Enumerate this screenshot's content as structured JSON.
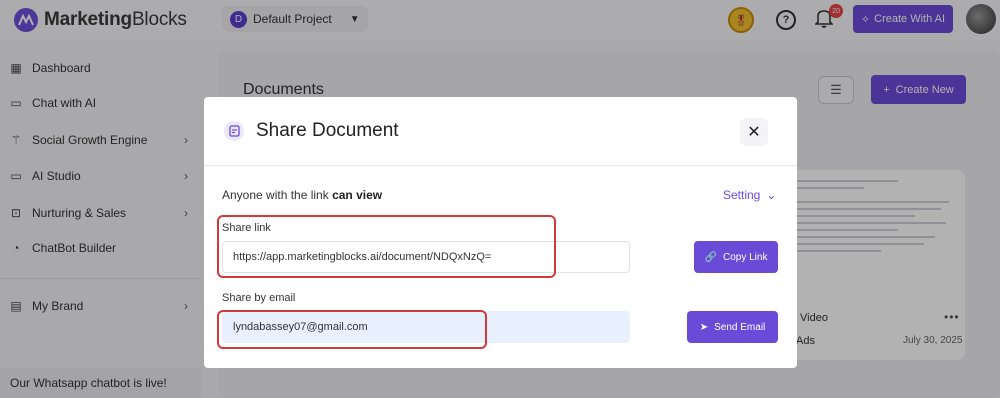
{
  "app": {
    "brand_bold": "Marketing",
    "brand_light": "Blocks"
  },
  "topbar": {
    "project_initial": "D",
    "project_name": "Default Project",
    "notifications_count": "20",
    "create_ai_label": "Create With AI"
  },
  "sidebar": {
    "items": [
      {
        "label": "Dashboard",
        "icon": "dashboard-icon"
      },
      {
        "label": "Chat with AI",
        "icon": "chat-icon"
      },
      {
        "label": "Social Growth Engine",
        "icon": "wand-icon"
      },
      {
        "label": "AI Studio",
        "icon": "monitor-icon"
      },
      {
        "label": "Nurturing & Sales",
        "icon": "presentation-icon"
      },
      {
        "label": "ChatBot Builder",
        "icon": "bot-icon"
      },
      {
        "label": "My Brand",
        "icon": "brand-icon"
      }
    ],
    "whatsapp_notice": "Our Whatsapp chatbot is live!"
  },
  "main": {
    "title": "Documents",
    "create_new_label": "Create New",
    "card": {
      "title": "Video",
      "subtitle": "Ads",
      "date": "July 30, 2025"
    }
  },
  "modal": {
    "title": "Share Document",
    "access_prefix": "Anyone with the link",
    "access_level": "can view",
    "setting_label": "Setting",
    "share_link_label": "Share link",
    "share_link_value": "https://app.marketingblocks.ai/document/NDQxNzQ=",
    "copy_link_label": "Copy Link",
    "share_email_label": "Share by email",
    "email_value": "lyndabassey07@gmail.com",
    "send_email_label": "Send Email"
  },
  "colors": {
    "accent": "#6a4bd8",
    "highlight_box": "#d03a3a"
  }
}
